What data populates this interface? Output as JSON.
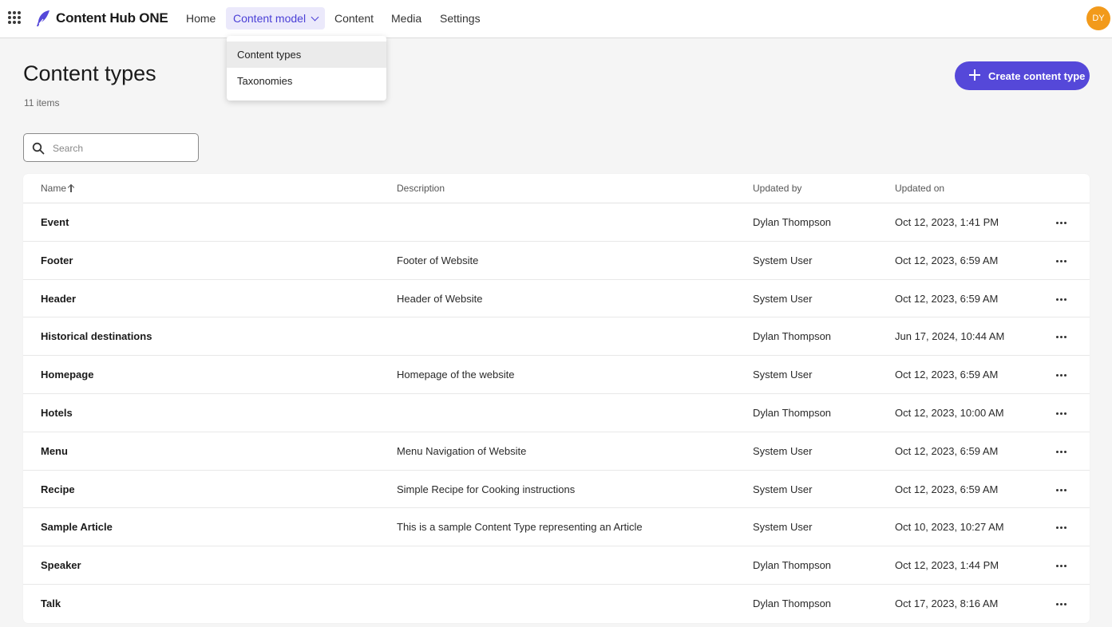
{
  "app": {
    "name": "Content Hub ONE",
    "avatar_initials": "DY",
    "accent": "#5548d9",
    "avatar_color": "#f29a1b"
  },
  "nav": {
    "home": "Home",
    "content_model": "Content model",
    "content": "Content",
    "media": "Media",
    "settings": "Settings"
  },
  "dropdown": {
    "items": [
      "Content types",
      "Taxonomies"
    ],
    "highlighted": "Content types"
  },
  "page": {
    "title": "Content types",
    "count": "11 items",
    "create_label": "Create content type"
  },
  "search": {
    "placeholder": "Search",
    "value": ""
  },
  "table": {
    "columns": {
      "name": "Name",
      "description": "Description",
      "updated_by": "Updated by",
      "updated_on": "Updated on"
    },
    "sort": {
      "column": "Name",
      "direction": "ascending"
    },
    "rows": [
      {
        "name": "Event",
        "description": "",
        "updated_by": "Dylan Thompson",
        "updated_on": "Oct 12, 2023, 1:41 PM"
      },
      {
        "name": "Footer",
        "description": "Footer of Website",
        "updated_by": "System User",
        "updated_on": "Oct 12, 2023, 6:59 AM"
      },
      {
        "name": "Header",
        "description": "Header of Website",
        "updated_by": "System User",
        "updated_on": "Oct 12, 2023, 6:59 AM"
      },
      {
        "name": "Historical destinations",
        "description": "",
        "updated_by": "Dylan Thompson",
        "updated_on": "Jun 17, 2024, 10:44 AM"
      },
      {
        "name": "Homepage",
        "description": "Homepage of the website",
        "updated_by": "System User",
        "updated_on": "Oct 12, 2023, 6:59 AM"
      },
      {
        "name": "Hotels",
        "description": "",
        "updated_by": "Dylan Thompson",
        "updated_on": "Oct 12, 2023, 10:00 AM"
      },
      {
        "name": "Menu",
        "description": "Menu Navigation of Website",
        "updated_by": "System User",
        "updated_on": "Oct 12, 2023, 6:59 AM"
      },
      {
        "name": "Recipe",
        "description": "Simple Recipe for Cooking instructions",
        "updated_by": "System User",
        "updated_on": "Oct 12, 2023, 6:59 AM"
      },
      {
        "name": "Sample Article",
        "description": "This is a sample Content Type representing an Article",
        "updated_by": "System User",
        "updated_on": "Oct 10, 2023, 10:27 AM"
      },
      {
        "name": "Speaker",
        "description": "",
        "updated_by": "Dylan Thompson",
        "updated_on": "Oct 12, 2023, 1:44 PM"
      },
      {
        "name": "Talk",
        "description": "",
        "updated_by": "Dylan Thompson",
        "updated_on": "Oct 17, 2023, 8:16 AM"
      }
    ]
  }
}
